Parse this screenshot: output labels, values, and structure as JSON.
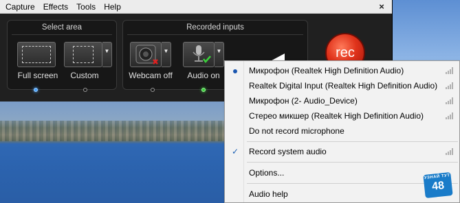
{
  "menubar": {
    "items": [
      "Capture",
      "Effects",
      "Tools",
      "Help"
    ],
    "close_label": "×"
  },
  "select_area": {
    "title": "Select area",
    "tools": [
      {
        "label": "Full screen",
        "active": true
      },
      {
        "label": "Custom",
        "active": false
      }
    ]
  },
  "recorded_inputs": {
    "title": "Recorded inputs",
    "tools": [
      {
        "label": "Webcam off",
        "status": "off"
      },
      {
        "label": "Audio on",
        "status": "on"
      }
    ]
  },
  "rec_button": {
    "label": "rec",
    "color": "#e0331b"
  },
  "audio_menu": {
    "devices": [
      {
        "label": "Микрофон (Realtek High Definition Audio)",
        "selected": true
      },
      {
        "label": "Realtek Digital Input (Realtek High Definition Audio)",
        "selected": false
      },
      {
        "label": "Микрофон (2- Audio_Device)",
        "selected": false
      },
      {
        "label": "Стерео микшер (Realtek High Definition Audio)",
        "selected": false
      }
    ],
    "no_mic": "Do not record microphone",
    "system_audio": {
      "label": "Record system audio",
      "checked": true,
      "check_mark": "✓"
    },
    "options": "Options...",
    "help": "Audio help"
  },
  "watermark": {
    "top_text": "УЗНАЙ ТУТ",
    "number": "48"
  },
  "colors": {
    "accent_blue": "#4aa3ff",
    "active_green": "#3bd13b",
    "menu_check": "#1a5fb4"
  }
}
